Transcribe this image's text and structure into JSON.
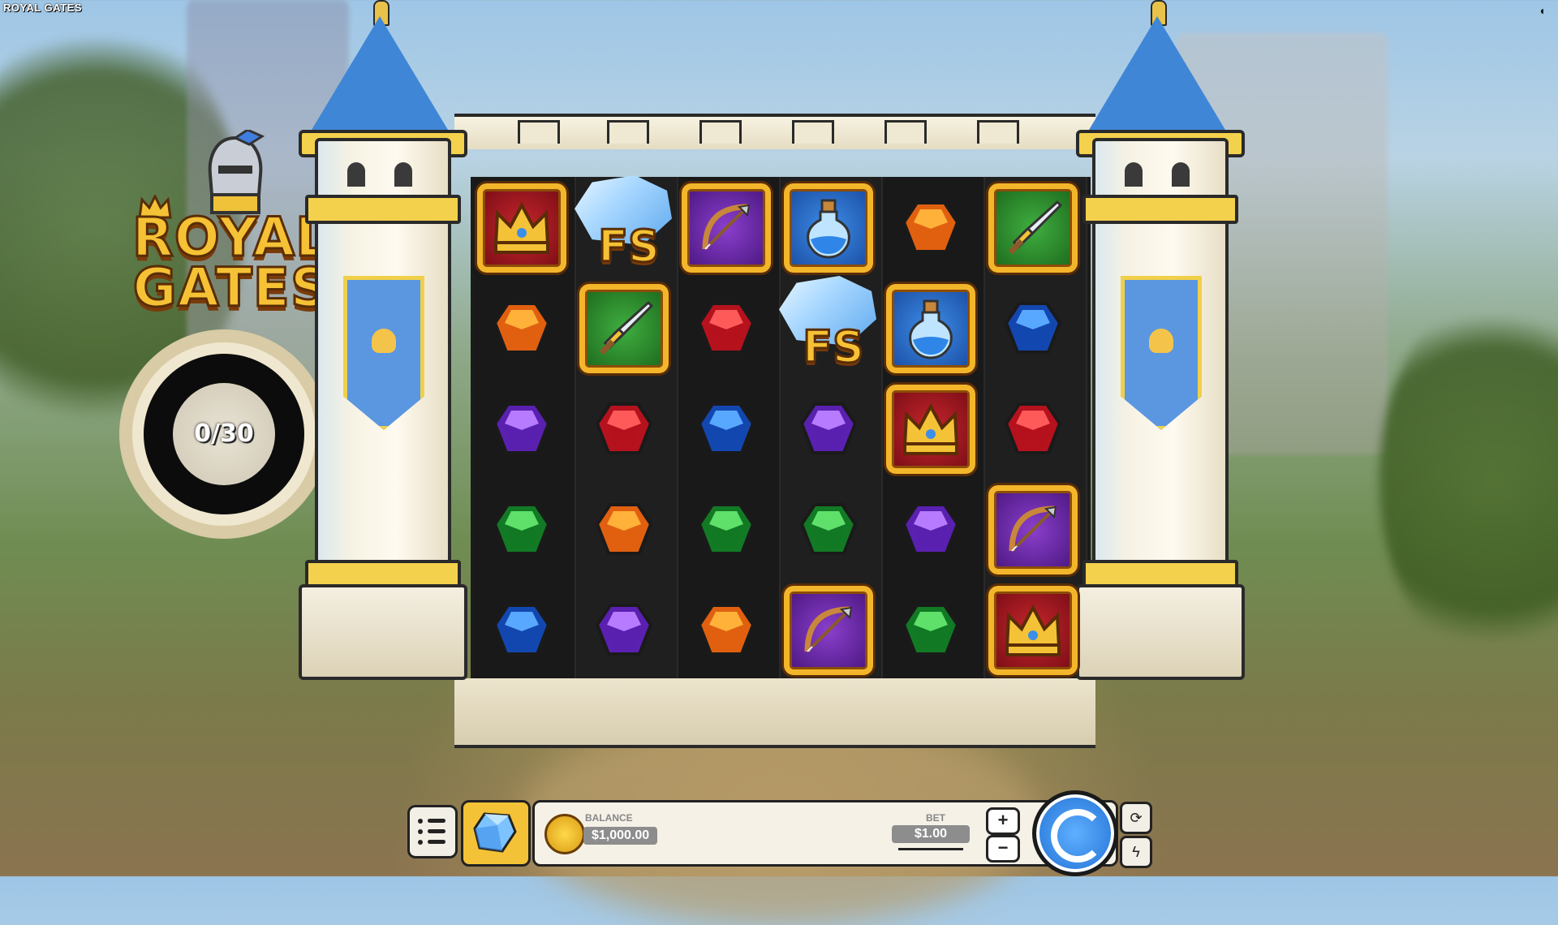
{
  "header": {
    "title": "ROYAL GATES"
  },
  "logo": {
    "line1": "ROYAL",
    "line2": "GATES"
  },
  "counter": {
    "text": "0/30"
  },
  "symbols": {
    "fs_label": "FS"
  },
  "grid": {
    "columns": 6,
    "rows": 5,
    "cells": [
      [
        "crown-tile",
        "fs-crystal",
        "bow-tile",
        "potion-tile",
        "orange-gem",
        "sword-tile"
      ],
      [
        "orange-gem",
        "sword-tile",
        "red-gem",
        "fs-crystal",
        "potion-tile",
        "blue-gem"
      ],
      [
        "purple-gem",
        "red-gem",
        "blue-gem",
        "purple-gem",
        "crown-tile",
        "red-gem"
      ],
      [
        "green-gem",
        "orange-gem",
        "green-gem",
        "green-gem",
        "purple-gem",
        "bow-tile"
      ],
      [
        "blue-gem",
        "purple-gem",
        "orange-gem",
        "bow-tile",
        "green-gem",
        "crown-tile"
      ]
    ]
  },
  "bottom_bar": {
    "balance_label": "BALANCE",
    "balance_value": "$1,000.00",
    "bet_label": "BET",
    "bet_value": "$1.00",
    "plus_label": "+",
    "minus_label": "−"
  },
  "colors": {
    "gold": "#f6c235",
    "tower_blue": "#3f86d6",
    "spin_blue": "#1e6ed3"
  }
}
